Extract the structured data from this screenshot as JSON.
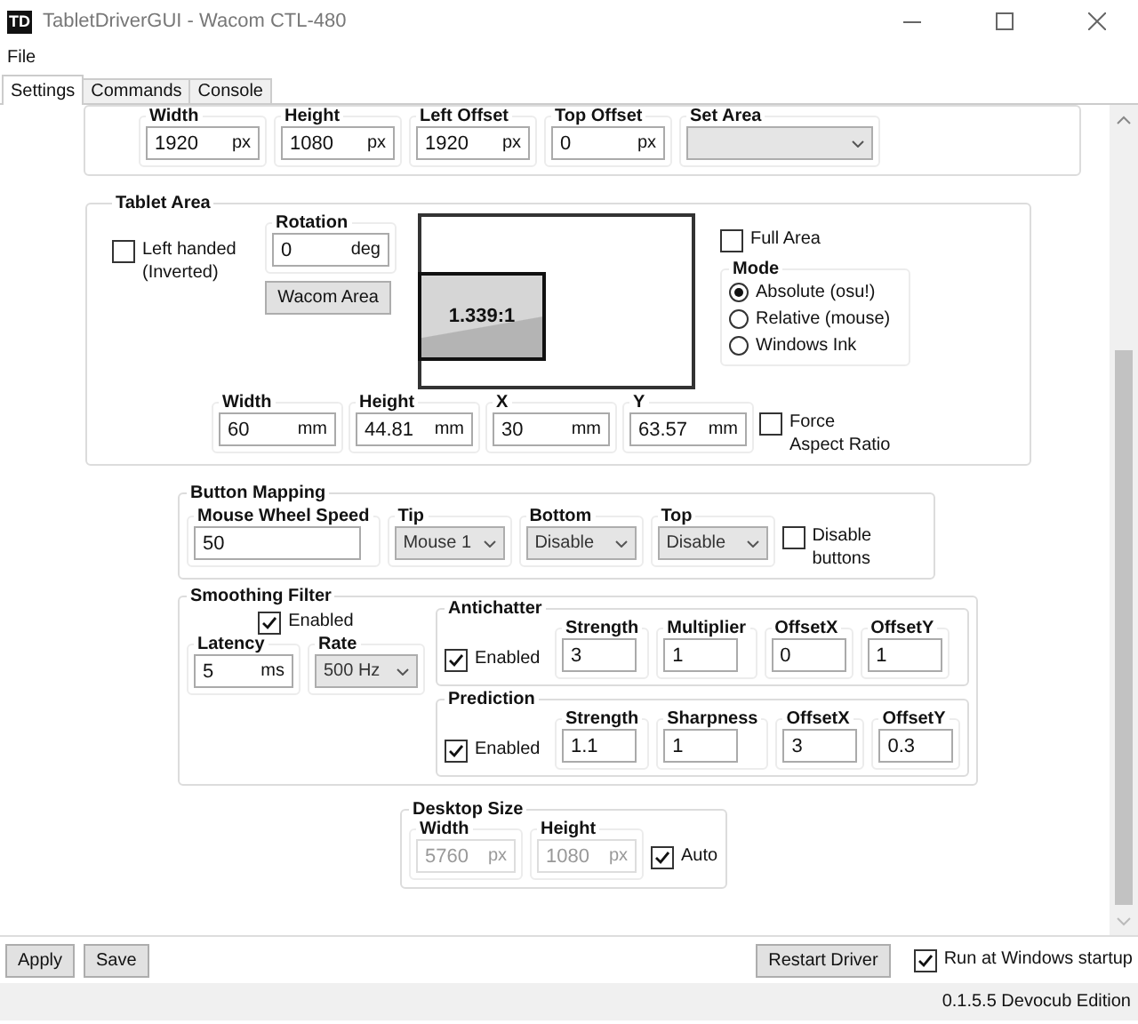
{
  "window": {
    "icon": "TD",
    "title": "TabletDriverGUI - Wacom CTL-480"
  },
  "menu": [
    {
      "label": "File"
    }
  ],
  "tabs": [
    {
      "label": "Settings",
      "selected": true
    },
    {
      "label": "Commands",
      "selected": false
    },
    {
      "label": "Console",
      "selected": false
    }
  ],
  "screen_area": {
    "fields": [
      {
        "label": "Width",
        "value": "1920",
        "unit": "px"
      },
      {
        "label": "Height",
        "value": "1080",
        "unit": "px"
      },
      {
        "label": "Left Offset",
        "value": "1920",
        "unit": "px"
      },
      {
        "label": "Top Offset",
        "value": "0",
        "unit": "px"
      }
    ],
    "set_area": {
      "label": "Set Area"
    }
  },
  "tablet_area": {
    "title": "Tablet Area",
    "left_handed": {
      "label": "Left handed\n(Inverted)",
      "checked": false
    },
    "rotation": {
      "label": "Rotation",
      "value": "0",
      "unit": "deg"
    },
    "wacom_area_button": "Wacom Area",
    "aspect_ratio": "1.339:1",
    "full_area": {
      "label": "Full Area",
      "checked": false
    },
    "mode": {
      "title": "Mode",
      "options": [
        {
          "label": "Absolute (osu!)",
          "selected": true
        },
        {
          "label": "Relative (mouse)",
          "selected": false
        },
        {
          "label": "Windows Ink",
          "selected": false
        }
      ]
    },
    "fields": [
      {
        "label": "Width",
        "value": "60",
        "unit": "mm"
      },
      {
        "label": "Height",
        "value": "44.81",
        "unit": "mm"
      },
      {
        "label": "X",
        "value": "30",
        "unit": "mm"
      },
      {
        "label": "Y",
        "value": "63.57",
        "unit": "mm"
      }
    ],
    "force_aspect_ratio": {
      "label": "Force\nAspect Ratio",
      "checked": false
    }
  },
  "button_mapping": {
    "title": "Button Mapping",
    "wheel_speed": {
      "label": "Mouse Wheel Speed",
      "value": "50"
    },
    "dropdowns": [
      {
        "label": "Tip",
        "value": "Mouse 1"
      },
      {
        "label": "Bottom",
        "value": "Disable"
      },
      {
        "label": "Top",
        "value": "Disable"
      }
    ],
    "disable_buttons": {
      "label": "Disable buttons",
      "checked": false
    }
  },
  "smoothing_filter": {
    "title": "Smoothing Filter",
    "enabled": {
      "label": "Enabled",
      "checked": true
    },
    "latency": {
      "label": "Latency",
      "value": "5",
      "unit": "ms"
    },
    "rate": {
      "label": "Rate",
      "value": "500 Hz"
    },
    "antichatter": {
      "title": "Antichatter",
      "enabled": {
        "label": "Enabled",
        "checked": true
      },
      "fields": [
        {
          "label": "Strength",
          "value": "3"
        },
        {
          "label": "Multiplier",
          "value": "1"
        },
        {
          "label": "OffsetX",
          "value": "0"
        },
        {
          "label": "OffsetY",
          "value": "1"
        }
      ]
    },
    "prediction": {
      "title": "Prediction",
      "enabled": {
        "label": "Enabled",
        "checked": true
      },
      "fields": [
        {
          "label": "Strength",
          "value": "1.1"
        },
        {
          "label": "Sharpness",
          "value": "1"
        },
        {
          "label": "OffsetX",
          "value": "3"
        },
        {
          "label": "OffsetY",
          "value": "0.3"
        }
      ]
    }
  },
  "desktop_size": {
    "title": "Desktop Size",
    "fields": [
      {
        "label": "Width",
        "value": "5760",
        "unit": "px",
        "disabled": true
      },
      {
        "label": "Height",
        "value": "1080",
        "unit": "px",
        "disabled": true
      }
    ],
    "auto": {
      "label": "Auto",
      "checked": true
    }
  },
  "buttons": [
    {
      "label": "Apply"
    },
    {
      "label": "Save"
    }
  ],
  "restart_button": "Restart Driver",
  "run_at_startup": {
    "label": "Run at Windows startup",
    "checked": true
  },
  "status_bar": "0.1.5.5 Devocub Edition"
}
